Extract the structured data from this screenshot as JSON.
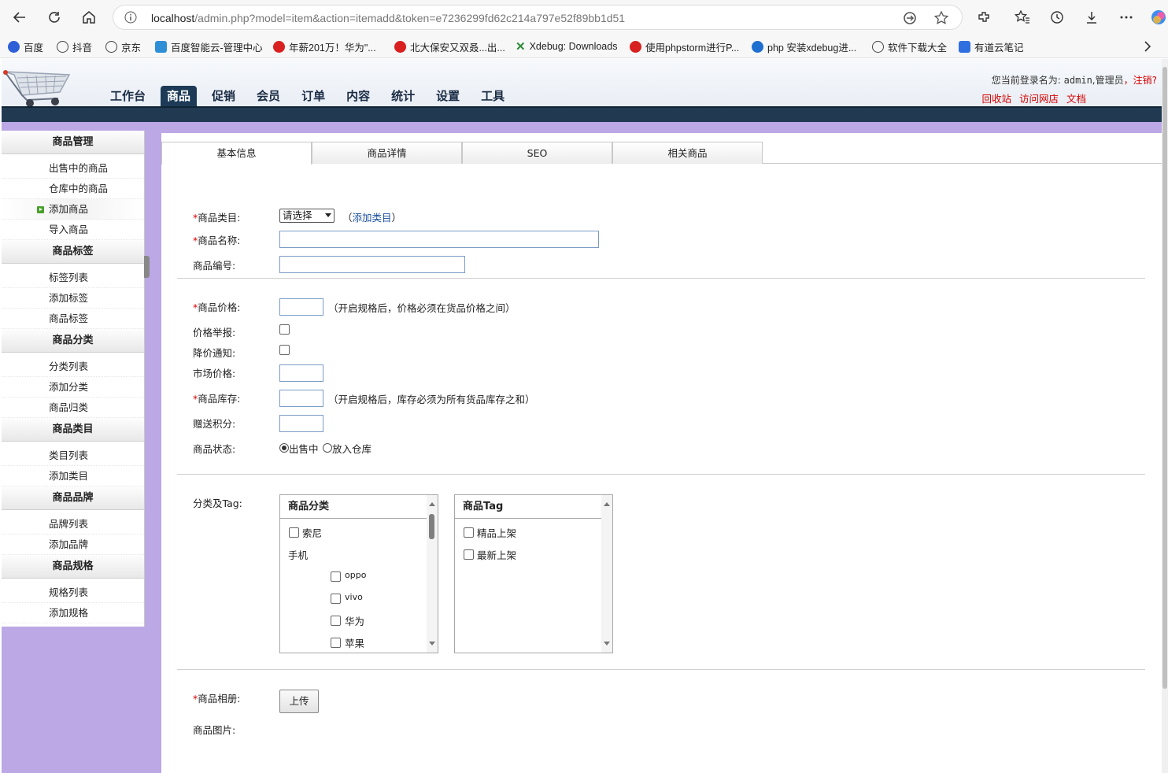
{
  "browser": {
    "url_host": "localhost",
    "url_path": "/admin.php?model=item&action=itemadd&token=e7236299fd62c214a797e52f89bb1d51",
    "bookmarks": [
      {
        "label": "百度",
        "color": "#2f5fd6"
      },
      {
        "label": "抖音",
        "color": "#444444"
      },
      {
        "label": "京东",
        "color": "#444444"
      },
      {
        "label": "百度智能云-管理中心",
        "color": "#2f8fd6"
      },
      {
        "label": "年薪201万！华为\"...",
        "color": "#d82020"
      },
      {
        "label": "北大保安又双叒...出...",
        "color": "#d82020"
      },
      {
        "label": "Xdebug: Downloads",
        "color": "#2e8b3a"
      },
      {
        "label": "使用phpstorm进行P...",
        "color": "#d82020"
      },
      {
        "label": "php 安装xdebug进...",
        "color": "#1f6fd0"
      },
      {
        "label": "软件下载大全",
        "color": "#444444"
      },
      {
        "label": "有道云笔记",
        "color": "#2f6fe0"
      }
    ]
  },
  "header": {
    "nav": [
      "工作台",
      "商品",
      "促销",
      "会员",
      "订单",
      "内容",
      "统计",
      "设置",
      "工具"
    ],
    "active_nav": "商品",
    "login_prefix": "您当前登录名为:",
    "login_user": "admin",
    "login_role": ",管理员",
    "logout": "，注销?",
    "links": [
      "回收站",
      "访问网店",
      "文档"
    ]
  },
  "sidebar": {
    "sections": [
      {
        "title": "商品管理",
        "items": [
          "出售中的商品",
          "仓库中的商品",
          "添加商品",
          "导入商品"
        ]
      },
      {
        "title": "商品标签",
        "items": [
          "标签列表",
          "添加标签",
          "商品标签"
        ]
      },
      {
        "title": "商品分类",
        "items": [
          "分类列表",
          "添加分类",
          "商品归类"
        ]
      },
      {
        "title": "商品类目",
        "items": [
          "类目列表",
          "添加类目"
        ]
      },
      {
        "title": "商品品牌",
        "items": [
          "品牌列表",
          "添加品牌"
        ]
      },
      {
        "title": "商品规格",
        "items": [
          "规格列表",
          "添加规格"
        ]
      }
    ],
    "active_item": "添加商品"
  },
  "tabs": [
    "基本信息",
    "商品详情",
    "SEO",
    "相关商品"
  ],
  "form": {
    "category_label": "商品类目:",
    "category_select": "请选择",
    "add_category_link": "添加类目",
    "name_label": "商品名称:",
    "code_label": "商品编号:",
    "price_label": "商品价格:",
    "price_note": "（开启规格后，价格必须在货品价格之间）",
    "price_report_label": "价格举报:",
    "price_drop_label": "降价通知:",
    "market_price_label": "市场价格:",
    "stock_label": "商品库存:",
    "stock_note": "（开启规格后，库存必须为所有货品库存之和）",
    "points_label": "赠送积分:",
    "status_label": "商品状态:",
    "status_options": [
      "出售中",
      "放入仓库"
    ],
    "status_selected": "出售中",
    "class_tag_label": "分类及Tag:",
    "class_box_title": "商品分类",
    "class_items": {
      "top": "索尼",
      "group": "手机",
      "sub": [
        "oppo",
        "vivo",
        "华为",
        "苹果"
      ]
    },
    "tag_box_title": "商品Tag",
    "tag_items": [
      "精品上架",
      "最新上架"
    ],
    "album_label": "商品相册:",
    "upload_button": "上传",
    "image_label": "商品图片:"
  }
}
